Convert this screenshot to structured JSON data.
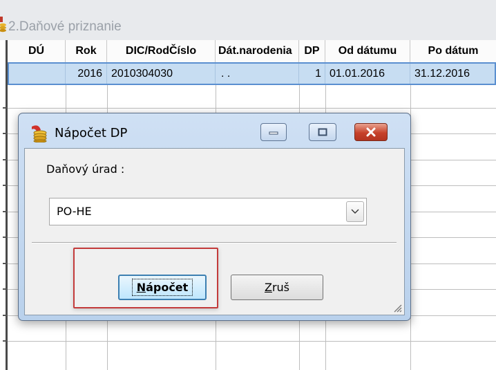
{
  "background_window": {
    "title": "2.Daňové priznanie",
    "columns": [
      "DÚ",
      "Rok",
      "DIC/RodČíslo",
      "Dát.narodenia",
      "DP",
      "Od dátumu",
      "Po dátum"
    ],
    "selected_row": {
      "du": "",
      "rok": "2016",
      "dic": "2010304030",
      "dat_narodenia": ". .",
      "dp": "1",
      "od_datumu": "01.01.2016",
      "po_datum": "31.12.2016"
    }
  },
  "dialog": {
    "title": "Nápočet DP",
    "tax_office_label": "Daňový úrad :",
    "tax_office_value": "PO-HE",
    "confirm_label": "Nápočet",
    "cancel_label": "Zruš"
  },
  "colors": {
    "selection": "#c7ddf2",
    "dialog_frame": "#cfe0f4",
    "close_button": "#c6412a",
    "highlight_box": "#c33a3a"
  },
  "icons": [
    "database-icon",
    "minimize-icon",
    "maximize-icon",
    "close-icon",
    "chevron-down-icon",
    "resize-grip-icon"
  ]
}
